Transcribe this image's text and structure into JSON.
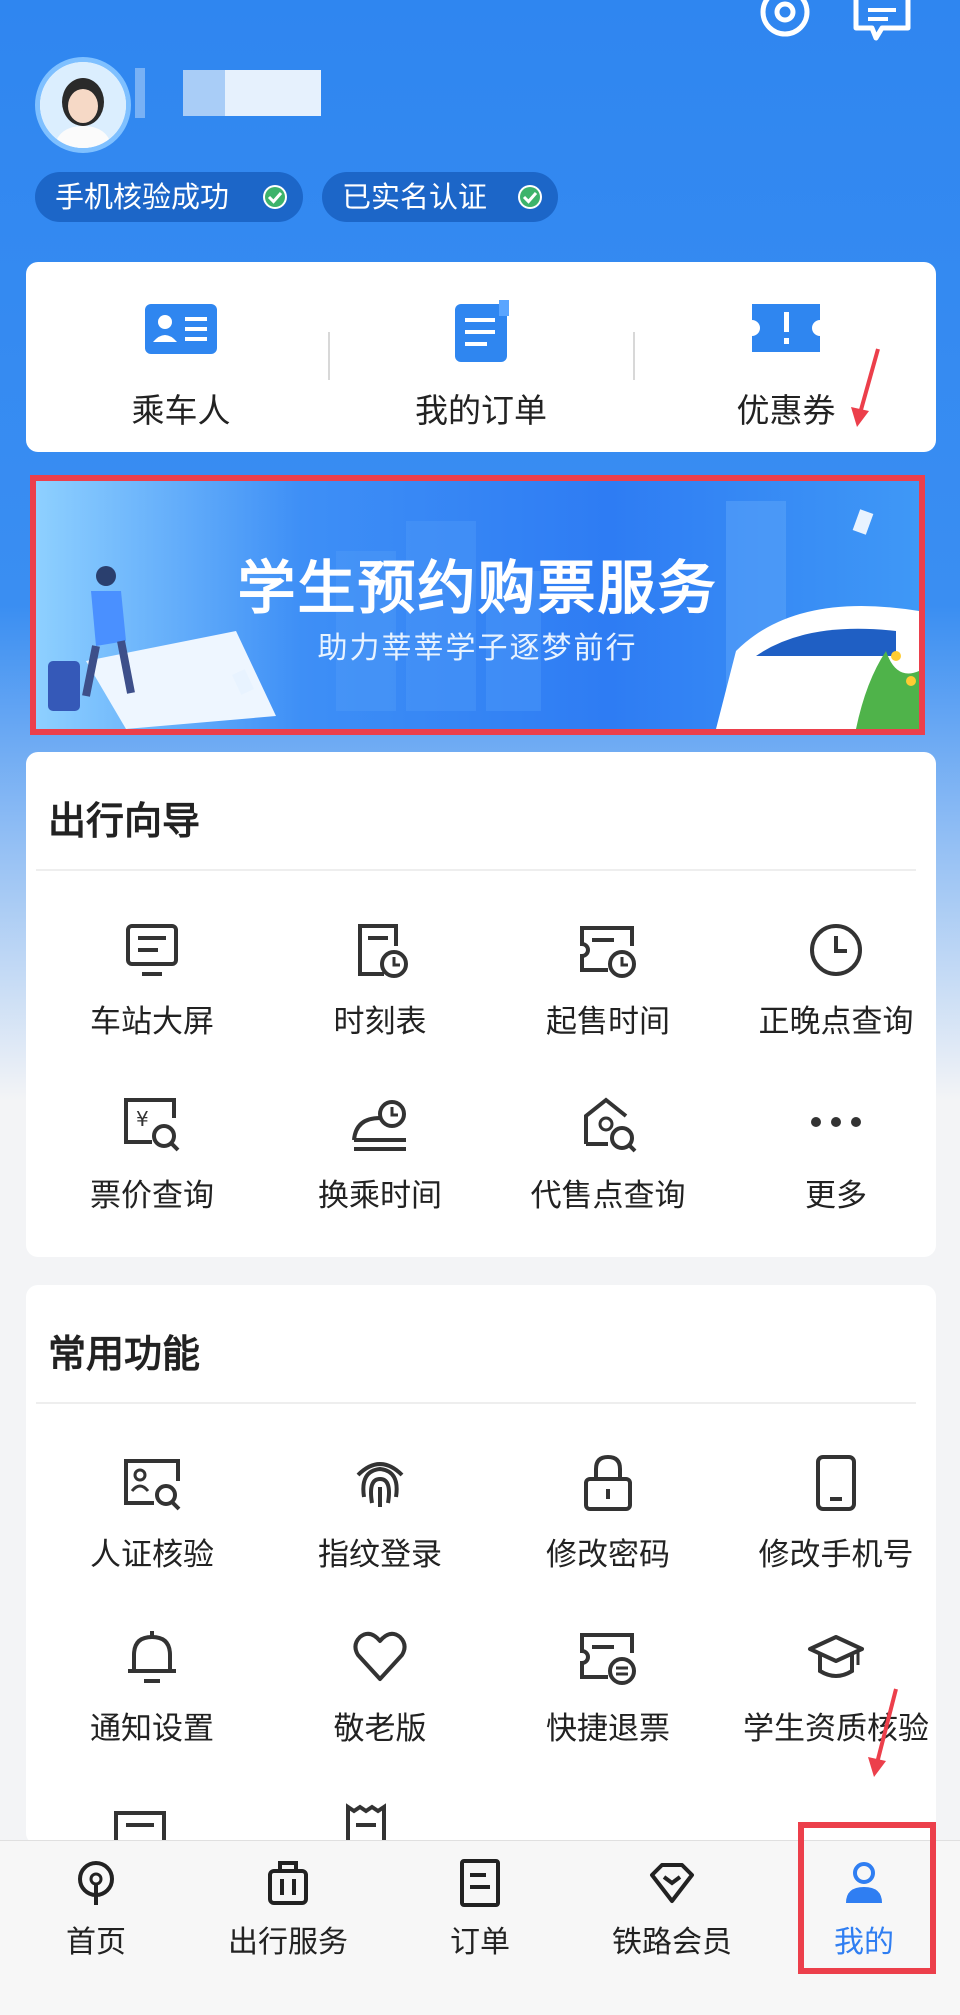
{
  "header": {
    "chips": [
      "手机核验成功",
      "已实名认证"
    ]
  },
  "quick": [
    {
      "label": "乘车人",
      "icon": "passenger-card-icon"
    },
    {
      "label": "我的订单",
      "icon": "order-document-icon"
    },
    {
      "label": "优惠券",
      "icon": "coupon-icon"
    }
  ],
  "banner": {
    "title": "学生预约购票服务",
    "subtitle": "助力莘莘学子逐梦前行"
  },
  "travel_guide": {
    "title": "出行向导",
    "items": [
      {
        "label": "车站大屏",
        "icon": "station-screen-icon"
      },
      {
        "label": "时刻表",
        "icon": "timetable-icon"
      },
      {
        "label": "起售时间",
        "icon": "sale-time-icon"
      },
      {
        "label": "正晚点查询",
        "icon": "clock-icon"
      },
      {
        "label": "票价查询",
        "icon": "fare-search-icon"
      },
      {
        "label": "换乘时间",
        "icon": "transfer-time-icon"
      },
      {
        "label": "代售点查询",
        "icon": "agency-search-icon"
      },
      {
        "label": "更多",
        "icon": "more-dots-icon"
      }
    ]
  },
  "common": {
    "title": "常用功能",
    "items": [
      {
        "label": "人证核验",
        "icon": "id-verify-icon"
      },
      {
        "label": "指纹登录",
        "icon": "fingerprint-icon"
      },
      {
        "label": "修改密码",
        "icon": "lock-icon"
      },
      {
        "label": "修改手机号",
        "icon": "phone-icon"
      },
      {
        "label": "通知设置",
        "icon": "bell-icon"
      },
      {
        "label": "敬老版",
        "icon": "heart-icon"
      },
      {
        "label": "快捷退票",
        "icon": "refund-ticket-icon"
      },
      {
        "label": "学生资质核验",
        "icon": "graduation-cap-icon"
      }
    ]
  },
  "tabs": [
    {
      "label": "首页",
      "icon": "home-train-icon"
    },
    {
      "label": "出行服务",
      "icon": "luggage-icon"
    },
    {
      "label": "订单",
      "icon": "order-list-icon"
    },
    {
      "label": "铁路会员",
      "icon": "diamond-icon"
    },
    {
      "label": "我的",
      "icon": "person-icon",
      "active": true
    }
  ],
  "colors": {
    "brand_blue": "#2f86f0",
    "highlight_red": "#ec3f4b",
    "active_tab": "#2f7ef2"
  }
}
